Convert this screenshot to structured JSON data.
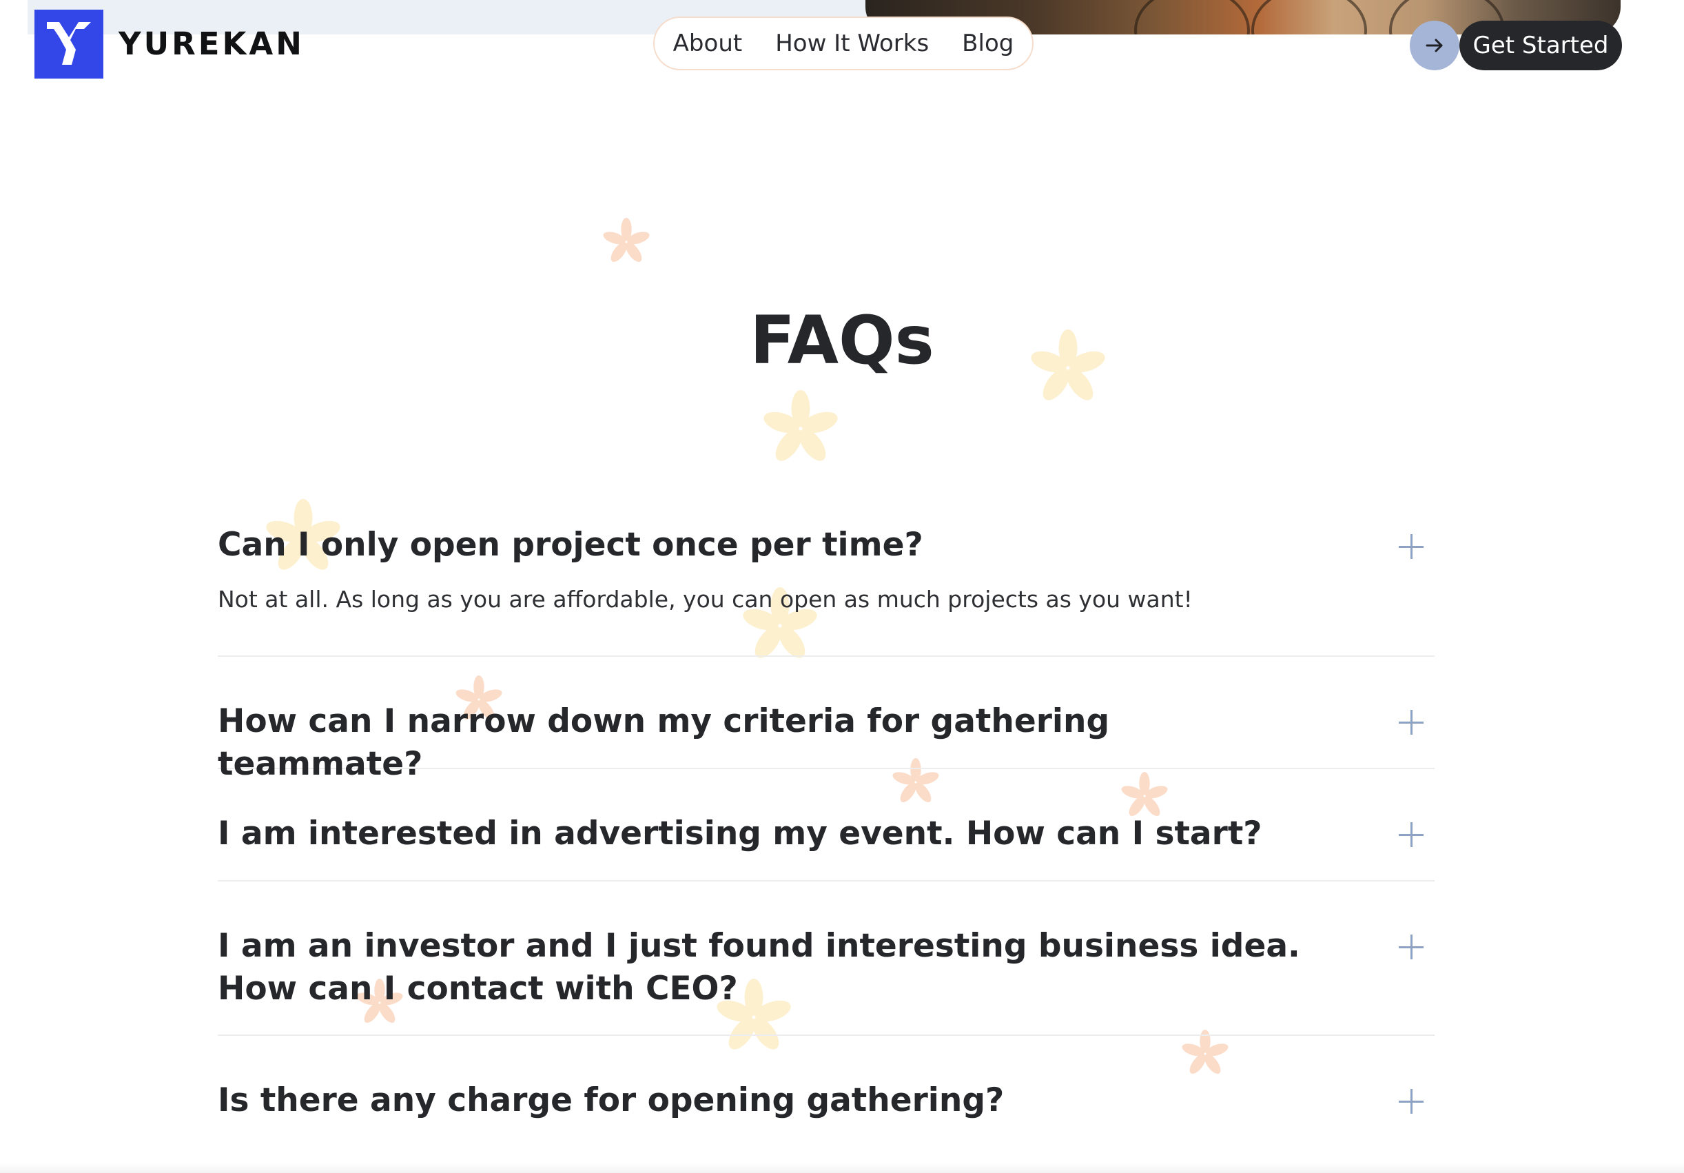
{
  "header": {
    "brand": "YUREKAN",
    "nav": [
      {
        "label": "About"
      },
      {
        "label": "How It Works"
      },
      {
        "label": "Blog"
      }
    ],
    "cta_label": "Get Started",
    "arrow_icon": "arrow-right-icon",
    "logo_icon": "yurekan-logo"
  },
  "faq": {
    "title": "FAQs",
    "items": [
      {
        "question": "Can I only open project once per time?",
        "answer": "Not at all. As long as you are affordable, you can open as much projects as you want!",
        "expanded": true
      },
      {
        "question": "How can I narrow down my criteria for gathering teammate?",
        "expanded": false
      },
      {
        "question": "I am interested in advertising my event. How can I start?",
        "expanded": false
      },
      {
        "question": "I am an investor and I just found interesting business idea. How can I contact with CEO?",
        "expanded": false
      },
      {
        "question": "Is there any charge for opening gathering?",
        "expanded": false
      }
    ]
  },
  "colors": {
    "brand_blue": "#3347e8",
    "text_dark": "#26272b",
    "cta_bg": "#26272b",
    "arrow_bg": "#a4b5d8",
    "plus_icon": "#8ea2c4",
    "divider": "#ededee",
    "flower_yellow": "#fdf0cf",
    "flower_peach": "#fbdcc9"
  }
}
